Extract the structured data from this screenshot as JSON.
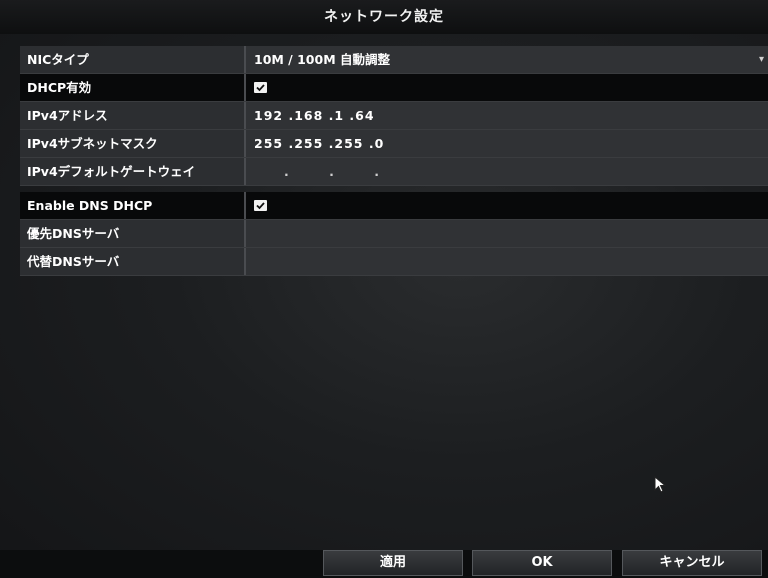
{
  "window": {
    "title": "ネットワーク設定"
  },
  "form": {
    "nic_type": {
      "label": "NICタイプ",
      "value": "10M / 100M 自動調整"
    },
    "dhcp": {
      "label": "DHCP有効",
      "checked": true
    },
    "ipv4_address": {
      "label": "IPv4アドレス",
      "value": "192 .168 .1    .64"
    },
    "subnet_mask": {
      "label": "IPv4サブネットマスク",
      "value": "255 .255 .255 .0"
    },
    "gateway": {
      "label": "IPv4デフォルトゲートウェイ",
      "value": ". . ."
    },
    "dns_dhcp": {
      "label": "Enable DNS DHCP",
      "checked": true
    },
    "preferred_dns": {
      "label": "優先DNSサーバ",
      "value": ""
    },
    "alternate_dns": {
      "label": "代替DNSサーバ",
      "value": ""
    }
  },
  "buttons": {
    "apply": "適用",
    "ok": "OK",
    "cancel": "キャンセル"
  }
}
